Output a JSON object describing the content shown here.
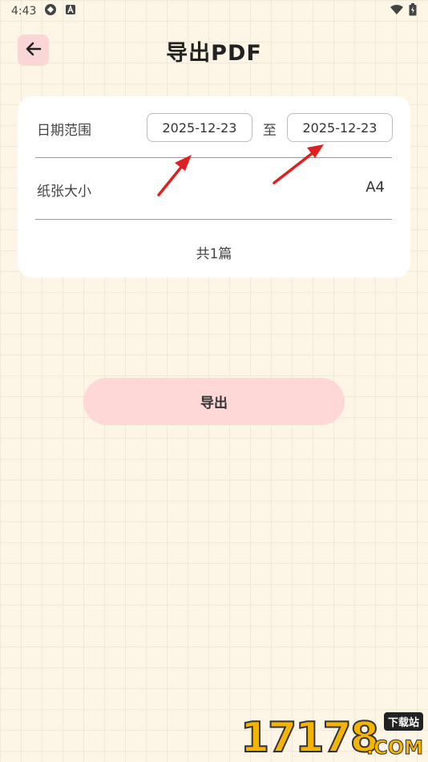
{
  "status_bar": {
    "time": "4:43",
    "icons": [
      "sync-icon",
      "a-notification-icon",
      "wifi-icon",
      "battery-icon"
    ]
  },
  "header": {
    "back_icon": "arrow-left-icon",
    "title": "导出PDF"
  },
  "form": {
    "date_range_label": "日期范围",
    "start_date": "2025-12-23",
    "to_label": "至",
    "end_date": "2025-12-23",
    "paper_size_label": "纸张大小",
    "paper_size_value": "A4",
    "count_text": "共1篇"
  },
  "export_button_label": "导出",
  "watermark": {
    "number": "17178",
    "tag": "下载站",
    "domain": ".COM"
  },
  "colors": {
    "background": "#fdf6e6",
    "accent_pink": "#fed7d7",
    "arrow_red": "#e02020",
    "watermark_yellow": "#f4b400"
  }
}
